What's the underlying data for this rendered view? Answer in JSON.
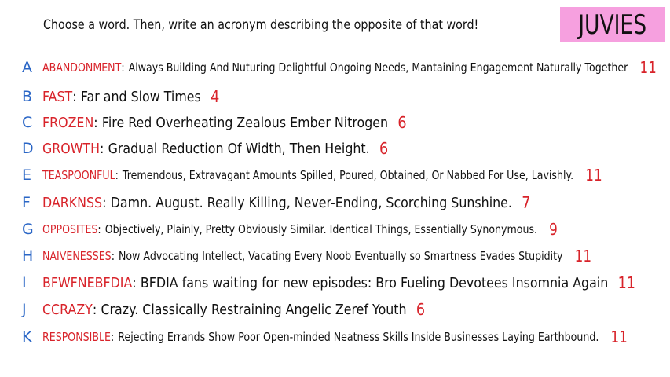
{
  "title": "Choose a word. Then, write an acronym describing the opposite of that word!",
  "badge": "JUVIES",
  "colors": {
    "letter": "#2a66c6",
    "word": "#d8232a",
    "count": "#d8232a",
    "badge_bg": "#f6a0df",
    "text": "#111111"
  },
  "rows": [
    {
      "letter": "A",
      "word": "ABANDONMENT",
      "acronym": "Always Building And Nuturing Delightful Ongoing Needs, Mantaining Engagement Naturally Together",
      "count": "11"
    },
    {
      "letter": "B",
      "word": "FAST",
      "acronym": "Far and Slow Times",
      "count": "4"
    },
    {
      "letter": "C",
      "word": "FROZEN",
      "acronym": "Fire Red Overheating Zealous Ember Nitrogen",
      "count": "6"
    },
    {
      "letter": "D",
      "word": "GROWTH",
      "acronym": "Gradual Reduction Of Width, Then Height.",
      "count": "6"
    },
    {
      "letter": "E",
      "word": "TEASPOONFUL",
      "acronym": "Tremendous, Extravagant Amounts Spilled, Poured, Obtained, Or Nabbed For Use, Lavishly.",
      "count": "11"
    },
    {
      "letter": "F",
      "word": "DARKNSS",
      "acronym": "Damn. August. Really Killing, Never-Ending, Scorching Sunshine.",
      "count": "7"
    },
    {
      "letter": "G",
      "word": "OPPOSITES",
      "acronym": "Objectively, Plainly, Pretty Obviously Similar. Identical Things, Essentially Synonymous.",
      "count": "9"
    },
    {
      "letter": "H",
      "word": "NAIVENESSES",
      "acronym": "Now Advocating Intellect, Vacating Every Noob Eventually so Smartness Evades Stupidity",
      "count": "11"
    },
    {
      "letter": "I",
      "word": "BFWFNEBFDIA",
      "acronym": "BFDIA fans waiting for new episodes: Bro Fueling Devotees Insomnia Again",
      "count": "11"
    },
    {
      "letter": "J",
      "word": "CCRAZY",
      "acronym": "Crazy. Classically Restraining Angelic Zeref Youth",
      "count": "6"
    },
    {
      "letter": "K",
      "word": "RESPONSIBLE",
      "acronym": "Rejecting Errands Show Poor Open-minded Neatness Skills Inside Businesses Laying Earthbound.",
      "count": "11"
    }
  ]
}
